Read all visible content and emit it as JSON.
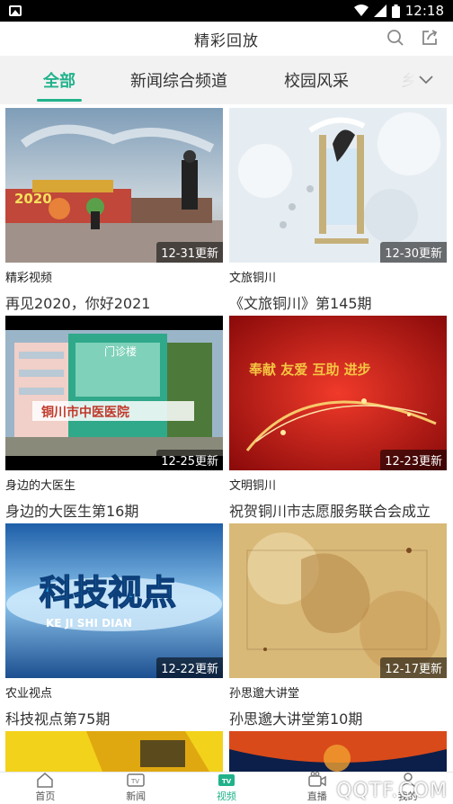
{
  "statusbar": {
    "time": "12:18"
  },
  "header": {
    "title": "精彩回放"
  },
  "tabs": [
    {
      "label": "全部",
      "active": true
    },
    {
      "label": "新闻综合频道",
      "active": false
    },
    {
      "label": "校园风采",
      "active": false
    },
    {
      "label": "乡",
      "active": false
    }
  ],
  "cards": [
    {
      "channel": "精彩视频",
      "title": "再见2020，你好2021",
      "badge": "12-31更新"
    },
    {
      "channel": "文旅铜川",
      "title": "《文旅铜川》第145期",
      "badge": "12-30更新"
    },
    {
      "channel": "身边的大医生",
      "title": "身边的大医生第16期",
      "badge": "12-25更新"
    },
    {
      "channel": "文明铜川",
      "title": "祝贺铜川市志愿服务联合会成立",
      "badge": "12-23更新"
    },
    {
      "channel": "农业视点",
      "title": "科技视点第75期",
      "badge": "12-22更新"
    },
    {
      "channel": "孙思邈大讲堂",
      "title": "孙思邈大讲堂第10期",
      "badge": "12-17更新"
    }
  ],
  "thumb_text": {
    "year": "2020",
    "hospital_banner": "铜川市中医医院",
    "hospital_sign": "门诊楼",
    "volunteer_banner": "奉献 友爱 互助 进步",
    "tech_title": "科技视点",
    "tech_pinyin": "KE  JI  SHI  DIAN"
  },
  "bottomnav": [
    {
      "label": "首页",
      "icon": "home-icon",
      "active": false
    },
    {
      "label": "新闻",
      "icon": "tv-icon",
      "active": false
    },
    {
      "label": "视频",
      "icon": "tv-filled-icon",
      "active": true
    },
    {
      "label": "直播",
      "icon": "camera-icon",
      "active": false
    },
    {
      "label": "我的",
      "icon": "person-icon",
      "active": false
    }
  ],
  "watermark": "QQTF.COM",
  "colors": {
    "accent": "#21b28b",
    "tabbar_bg": "#f2f2f2"
  }
}
